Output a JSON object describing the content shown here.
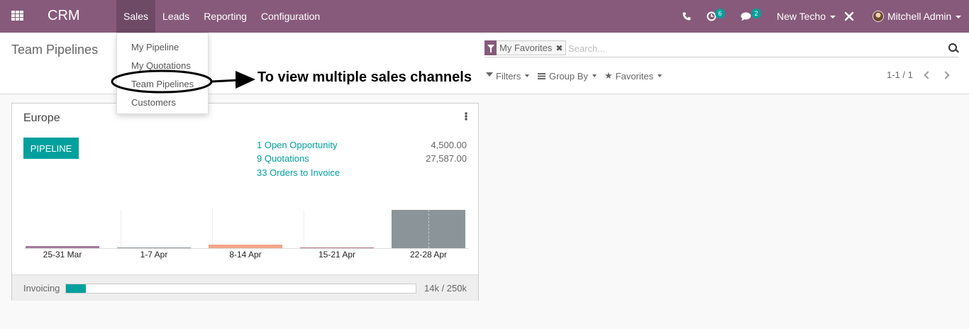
{
  "navbar": {
    "brand": "CRM",
    "menu": [
      "Sales",
      "Leads",
      "Reporting",
      "Configuration"
    ],
    "activity_count": "6",
    "message_count": "2",
    "company": "New Techo",
    "user": "Mitchell Admin",
    "icons": [
      "apps-icon",
      "phone-icon",
      "activity-clock-icon",
      "chat-icon",
      "debug-tools-icon"
    ]
  },
  "sales_menu": {
    "items": [
      "My Pipeline",
      "My Quotations",
      "Team Pipelines",
      "Customers"
    ]
  },
  "annotation": {
    "text": "To view multiple sales channels"
  },
  "control": {
    "title": "Team Pipelines",
    "facet": "My Favorites",
    "search_placeholder": "Search...",
    "filters": "Filters",
    "group_by": "Group By",
    "favorites": "Favorites",
    "pager": "1-1 / 1"
  },
  "card": {
    "team_name": "Europe",
    "button": "PIPELINE",
    "stats": [
      {
        "label": "1 Open Opportunity",
        "value": "4,500.00"
      },
      {
        "label": "9 Quotations",
        "value": "27,587.00"
      },
      {
        "label": "33 Orders to Invoice",
        "value": ""
      }
    ],
    "footer_label": "Invoicing",
    "footer_value": "14k / 250k",
    "progress_fraction": 0.056
  },
  "chart_data": {
    "type": "bar",
    "categories": [
      "25-31 Mar",
      "1-7 Apr",
      "8-14 Apr",
      "15-21 Apr",
      "22-28 Apr"
    ],
    "values": [
      2,
      1,
      4,
      1,
      40
    ],
    "colors": [
      "#a3799b",
      "#8a9498",
      "#f2a58a",
      "#b2737d",
      "#8a9499"
    ],
    "ylim": [
      0,
      40
    ],
    "grid": "vertical"
  },
  "colors": {
    "navbar": "#875a7b",
    "accent": "#00a09d"
  }
}
